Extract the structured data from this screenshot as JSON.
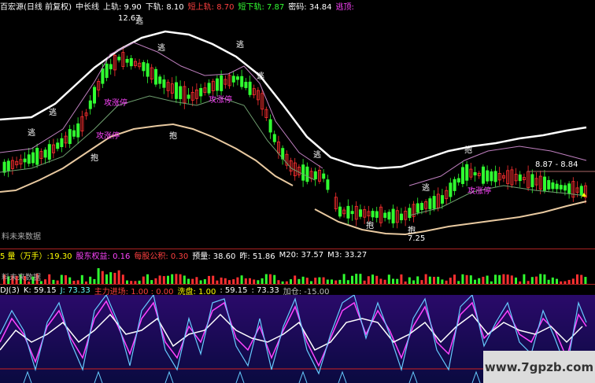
{
  "top_bar": {
    "title": "百宏源(日线 前复权)",
    "mid_label": "中长线",
    "upper_label": "上轨: 9.90",
    "lower_label": "下轨: 8.10",
    "short_upper": "短上轨: 8.70",
    "short_lower": "短下轨: 7.87",
    "chip": "密码: 34.84",
    "escape": "逃顶: ",
    "colors": {
      "white": "#ffffff",
      "yellow": "#ffff00",
      "red": "#ff4040",
      "green": "#33ff33",
      "magenta": "#ff44ff"
    }
  },
  "price_labels": {
    "high": "12.67",
    "level": "8.87 - 8.84",
    "low": "7.25",
    "escape_marks": [
      "逃",
      "逃",
      "逃",
      "逃",
      "逃",
      "逃",
      "逃",
      "逃"
    ],
    "buy_marks": [
      "抱",
      "抱",
      "抱",
      "抱",
      "抱"
    ],
    "limit_marks": [
      "攻涨停",
      "攻涨停",
      "攻涨停",
      "攻涨停"
    ],
    "no_data_1": "料未来数据"
  },
  "vol_bar": {
    "a": "5 量（万手）:19.30",
    "b": "股东权益: 0.16",
    "c": "每股公积: 0.30",
    "d": "预量: 38.60",
    "e": "昨: 51.86",
    "f": "M20: 37.57",
    "g": "M3: 33.27",
    "no_data_2": "料未来数据"
  },
  "kdj_bar": {
    "name": "DJ(3)",
    "k": "K: 59.15",
    "j": "J: 73.33",
    "main": "主力进场: 1.00 : 0.00",
    "wash": "洗盘: 1.00",
    "v1": ": 59.15",
    "v2": ": 73.33",
    "add": "加仓: -15.00"
  },
  "watermark": "www.7gpzb.com"
}
